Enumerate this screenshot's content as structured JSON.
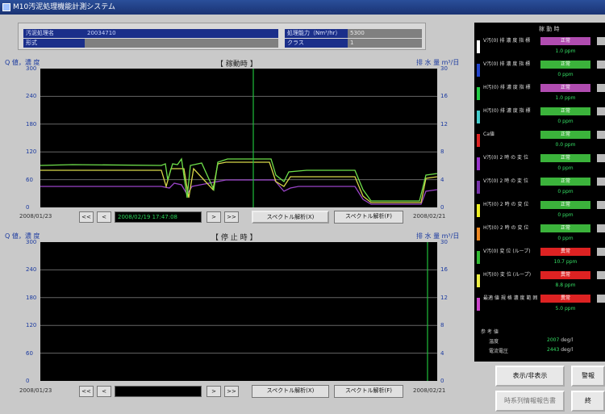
{
  "window": {
    "title": "M10汚泥処理機能計測システム"
  },
  "info": {
    "left": [
      {
        "label": "汚泥処理名",
        "value": "20034710"
      },
      {
        "label": "形式",
        "value": ""
      }
    ],
    "right": [
      {
        "label": "処理能力（Nm³/hr）",
        "value": "5300"
      },
      {
        "label": "クラス",
        "value": "1"
      }
    ]
  },
  "chart1": {
    "title": "【 稼動時 】",
    "ylabel_left": "Q 値，濃 度",
    "ylabel_right": "排 水 量 m³/日",
    "left_ticks": [
      "300",
      "240",
      "180",
      "120",
      "60",
      "0"
    ],
    "right_ticks": [
      "30",
      "16",
      "12",
      "8",
      "4",
      "0"
    ],
    "start_date": "2008/01/23",
    "end_date": "2008/02/21",
    "cursor_time": "2008/02/19 17:47:08",
    "btn_prev2": "<<",
    "btn_prev": "<",
    "btn_next": ">",
    "btn_next2": ">>",
    "btn_spectrum_start": "スペクトル解析(X)",
    "btn_spectrum_end": "スペクトル解析(F)"
  },
  "chart2": {
    "title": "【 停 止 時 】",
    "ylabel_left": "Q 値，濃 度",
    "ylabel_right": "排 水 量 m³/日",
    "left_ticks": [
      "300",
      "240",
      "180",
      "120",
      "60",
      "0"
    ],
    "right_ticks": [
      "30",
      "16",
      "12",
      "8",
      "4",
      "0"
    ],
    "start_date": "2008/01/23",
    "end_date": "2008/02/21",
    "cursor_time": "",
    "btn_prev2": "<<",
    "btn_prev": "<",
    "btn_next": ">",
    "btn_next2": ">>",
    "btn_spectrum_start": "スペクトル解析(X)",
    "btn_spectrum_end": "スペクトル解析(F)"
  },
  "sidebar": {
    "title": "稼 動 時",
    "rows": [
      {
        "color": "#ffffff",
        "label": "V汚(0) 排 濃 度 指 標",
        "status": "正常",
        "status_color": "#b04cb0",
        "reading": "1.0 ppm"
      },
      {
        "color": "#2244cc",
        "label": "V汚(0) 排 濃 度 指 標",
        "status": "正常",
        "status_color": "#3bb33b",
        "reading": "0 ppm"
      },
      {
        "color": "#22cc44",
        "label": "H汚(0) 排 濃 度 指 標",
        "status": "正常",
        "status_color": "#b04cb0",
        "reading": "1.0 ppm"
      },
      {
        "color": "#44cccc",
        "label": "H汚(0) 排 濃 度 指 標",
        "status": "正常",
        "status_color": "#3bb33b",
        "reading": "0 ppm"
      },
      {
        "color": "#dd2222",
        "label": "Ca値",
        "status": "正常",
        "status_color": "#3bb33b",
        "reading": "0.0 ppm"
      },
      {
        "color": "#9933cc",
        "label": "V汚(0) 2 時 の 変 位",
        "status": "正常",
        "status_color": "#3bb33b",
        "reading": "0 ppm"
      },
      {
        "color": "#7733aa",
        "label": "V汚(0) 2 時 の 変 位",
        "status": "正常",
        "status_color": "#3bb33b",
        "reading": "0 ppm"
      },
      {
        "color": "#eeee22",
        "label": "H汚(0) 2 時 の 変 位",
        "status": "正常",
        "status_color": "#3bb33b",
        "reading": "0 ppm"
      },
      {
        "color": "#ee8822",
        "label": "H汚(0) 2 時 の 変 位",
        "status": "正常",
        "status_color": "#3bb33b",
        "reading": "0 ppm"
      },
      {
        "color": "#33bb33",
        "label": "V汚(0) 変 位 (ループ)",
        "status": "異常",
        "status_color": "#dd2222",
        "reading": "10.7 ppm"
      },
      {
        "color": "#eeee44",
        "label": "H汚(0) 変 位 (ループ)",
        "status": "異常",
        "status_color": "#dd2222",
        "reading": "8.8 ppm"
      },
      {
        "color": "#cc44cc",
        "label": "最適 値 規 格 濃 度 範 囲",
        "status": "異常",
        "status_color": "#dd2222",
        "reading": "5.0 ppm"
      }
    ],
    "ref_title": "参 考 値",
    "ref_rows": [
      {
        "label": "温度",
        "value": "2007",
        "unit": "deg/l"
      },
      {
        "label": "電流電圧",
        "value": "2443",
        "unit": "deg/l"
      }
    ]
  },
  "buttons": {
    "show_hide": "表示/非表示",
    "right_top": "警報",
    "report": "時系列情報報告書",
    "right_bottom": "終"
  },
  "colors": {
    "series_green": "#6ee04a",
    "series_yellow": "#d8d84a",
    "series_purple": "#9a44c8",
    "cursor": "#1fbf3a"
  }
}
